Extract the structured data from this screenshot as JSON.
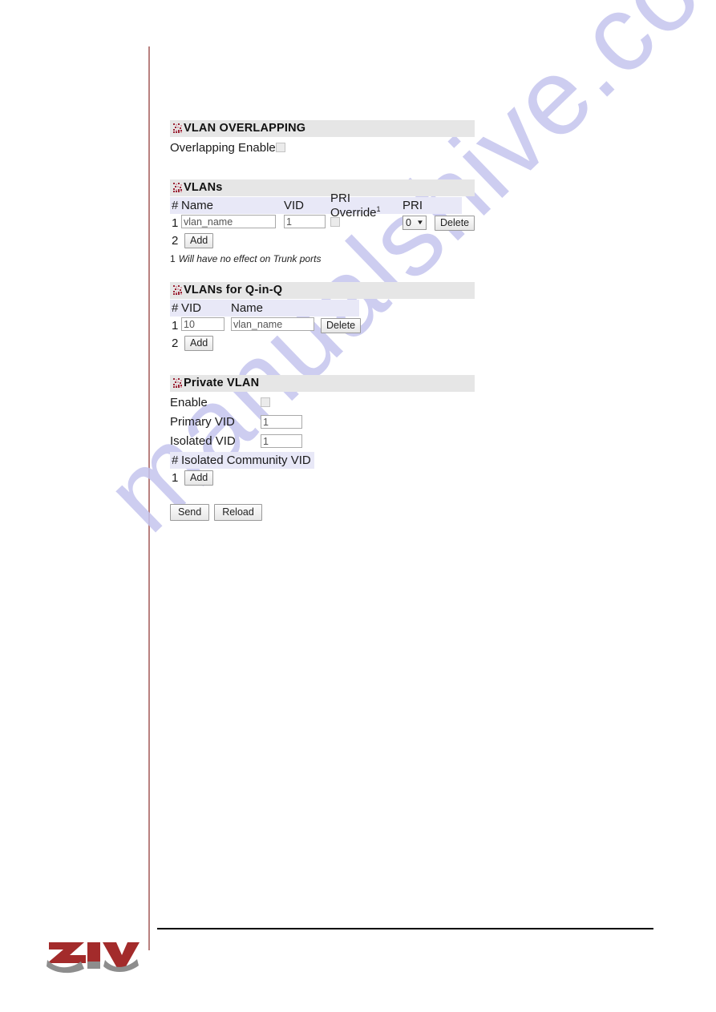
{
  "page": {
    "watermark_text": "manualshive.com",
    "brand_logo_text": "ZIV",
    "accent_rule_color": "#b9817f",
    "header_bar_color": "#e6e6e6",
    "table_header_color": "#e8e8f7",
    "icon_color": "#9b2335"
  },
  "sections": {
    "overlapping": {
      "title": "VLAN OVERLAPPING",
      "icon": "pixel-grid-icon",
      "enable_label": "Overlapping Enable",
      "enable_checked": false
    },
    "vlans": {
      "title": "VLANs",
      "icon": "pixel-grid-icon",
      "columns": {
        "index": "#",
        "name": "Name",
        "vid": "VID",
        "pri_override": "PRI Override",
        "pri_override_sup": "1",
        "pri": "PRI"
      },
      "rows": [
        {
          "index": "1",
          "name": "vlan_name",
          "vid": "1",
          "pri_override_checked": false,
          "pri": "0",
          "delete_label": "Delete"
        }
      ],
      "add_row_index": "2",
      "add_label": "Add",
      "footnote_num": "1",
      "footnote_text": "Will have no effect on Trunk ports"
    },
    "qinq": {
      "title": "VLANs for Q-in-Q",
      "icon": "pixel-grid-icon",
      "columns": {
        "index": "#",
        "vid": "VID",
        "name": "Name"
      },
      "rows": [
        {
          "index": "1",
          "vid": "10",
          "name": "vlan_name",
          "delete_label": "Delete"
        }
      ],
      "add_row_index": "2",
      "add_label": "Add"
    },
    "private_vlan": {
      "title": "Private VLAN",
      "icon": "pixel-grid-icon",
      "enable_label": "Enable",
      "enable_checked": false,
      "primary_vid_label": "Primary VID",
      "primary_vid_value": "1",
      "isolated_vid_label": "Isolated VID",
      "isolated_vid_value": "1",
      "community_columns": {
        "index": "#",
        "label": "Isolated Community VID"
      },
      "community_add_row_index": "1",
      "community_add_label": "Add"
    }
  },
  "form_actions": {
    "send_label": "Send",
    "reload_label": "Reload"
  }
}
